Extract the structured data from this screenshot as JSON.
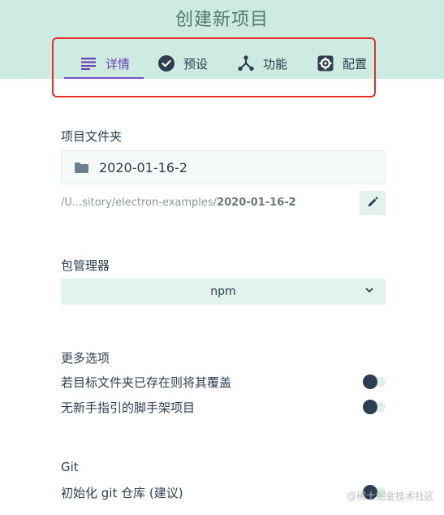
{
  "header": {
    "title": "创建新项目"
  },
  "tabs": [
    {
      "label": "详情",
      "icon": "details-list-icon",
      "active": true
    },
    {
      "label": "预设",
      "icon": "check-circle-icon",
      "active": false
    },
    {
      "label": "功能",
      "icon": "fork-icon",
      "active": false
    },
    {
      "label": "配置",
      "icon": "settings-gear-icon",
      "active": false
    }
  ],
  "project_folder": {
    "label": "项目文件夹",
    "value": "2020-01-16-2",
    "path_prefix": "/U...sitory/electron-examples/",
    "path_bold": "2020-01-16-2"
  },
  "package_manager": {
    "label": "包管理器",
    "selected": "npm"
  },
  "more_options": {
    "label": "更多选项",
    "options": [
      {
        "label": "若目标文件夹已存在则将其覆盖",
        "enabled": false
      },
      {
        "label": "无新手指引的脚手架项目",
        "enabled": false
      }
    ]
  },
  "git": {
    "label": "Git",
    "init_label": "初始化 git 仓库 (建议)",
    "enabled": false
  },
  "watermark": "@稀土掘金技术社区",
  "colors": {
    "header_bg": "#cdebe1",
    "accent": "#7b4fc6",
    "highlight_border": "#e0312b",
    "text": "#2c3e50"
  }
}
